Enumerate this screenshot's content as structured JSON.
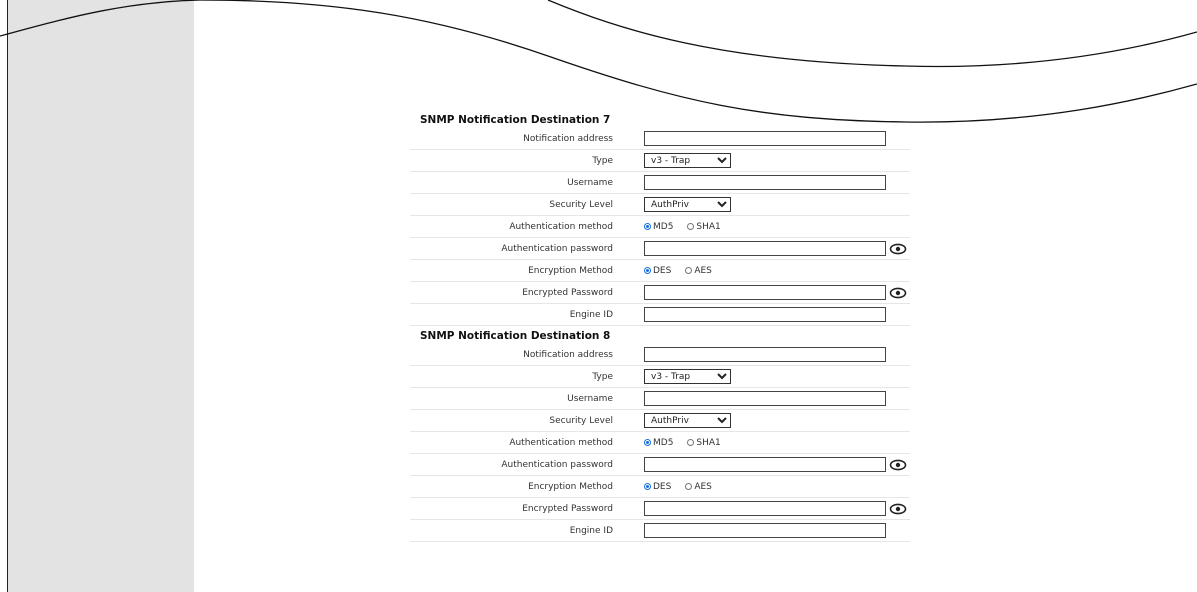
{
  "sections": [
    {
      "title": "SNMP Notification Destination 7",
      "fields": {
        "notification_address": {
          "label": "Notification address",
          "value": ""
        },
        "type": {
          "label": "Type",
          "value": "v3 - Trap"
        },
        "username": {
          "label": "Username",
          "value": ""
        },
        "security_level": {
          "label": "Security Level",
          "value": "AuthPriv"
        },
        "auth_method": {
          "label": "Authentication method",
          "options": [
            "MD5",
            "SHA1"
          ],
          "selected": "MD5"
        },
        "auth_password": {
          "label": "Authentication password",
          "value": ""
        },
        "enc_method": {
          "label": "Encryption Method",
          "options": [
            "DES",
            "AES"
          ],
          "selected": "DES"
        },
        "enc_password": {
          "label": "Encrypted Password",
          "value": ""
        },
        "engine_id": {
          "label": "Engine ID",
          "value": ""
        }
      }
    },
    {
      "title": "SNMP Notification Destination 8",
      "fields": {
        "notification_address": {
          "label": "Notification address",
          "value": ""
        },
        "type": {
          "label": "Type",
          "value": "v3 - Trap"
        },
        "username": {
          "label": "Username",
          "value": ""
        },
        "security_level": {
          "label": "Security Level",
          "value": "AuthPriv"
        },
        "auth_method": {
          "label": "Authentication method",
          "options": [
            "MD5",
            "SHA1"
          ],
          "selected": "MD5"
        },
        "auth_password": {
          "label": "Authentication password",
          "value": ""
        },
        "enc_method": {
          "label": "Encryption Method",
          "options": [
            "DES",
            "AES"
          ],
          "selected": "DES"
        },
        "enc_password": {
          "label": "Encrypted Password",
          "value": ""
        },
        "engine_id": {
          "label": "Engine ID",
          "value": ""
        }
      }
    }
  ],
  "colors": {
    "sidebar": "#e3e3e3",
    "radio_selected": "#1a6fe0"
  },
  "icons": {
    "password_toggle": "eye-icon"
  }
}
